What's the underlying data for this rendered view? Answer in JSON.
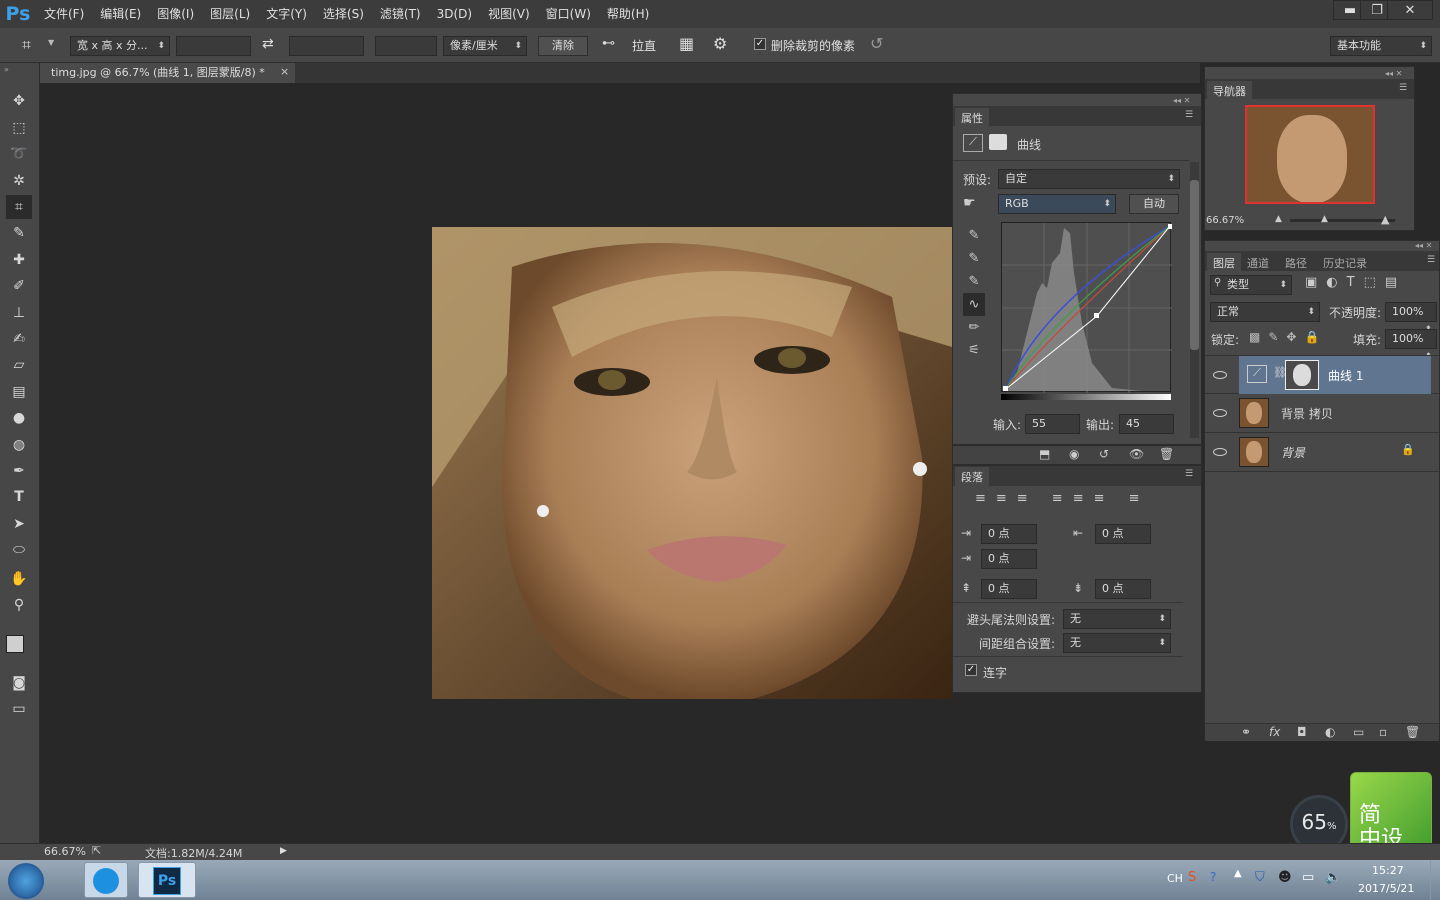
{
  "app": {
    "logo": "Ps",
    "accent": "#3da0e8"
  },
  "menubar": {
    "items": [
      "文件(F)",
      "编辑(E)",
      "图像(I)",
      "图层(L)",
      "文字(Y)",
      "选择(S)",
      "滤镜(T)",
      "3D(D)",
      "视图(V)",
      "窗口(W)",
      "帮助(H)"
    ],
    "window_buttons": [
      "▬",
      "❐",
      "✕"
    ]
  },
  "options": {
    "ratio": "宽 x 高 x 分...",
    "unit": "像素/厘米",
    "clear": "清除",
    "straighten": "拉直",
    "delete_cropped": "删除裁剪的像素",
    "workspace": "基本功能"
  },
  "document": {
    "tab_title": "timg.jpg @ 66.7% (曲线 1, 图层蒙版/8) *",
    "close": "×"
  },
  "properties": {
    "tab": "属性",
    "title": "曲线",
    "preset_label": "预设:",
    "preset_value": "自定",
    "channel": "RGB",
    "auto": "自动",
    "input_label": "输入:",
    "input_value": "55",
    "output_label": "输出:",
    "output_value": "45"
  },
  "paragraph": {
    "tab": "段落",
    "fields": [
      "0 点",
      "0 点",
      "0 点",
      "0 点",
      "0 点"
    ],
    "hyphen_label": "避头尾法则设置:",
    "hyphen_value": "无",
    "spacing_label": "间距组合设置:",
    "spacing_value": "无",
    "ligature_label": "连字"
  },
  "navigator": {
    "tab": "导航器",
    "zoom": "66.67%"
  },
  "layers": {
    "tabs": [
      "图层",
      "通道",
      "路径",
      "历史记录"
    ],
    "filter": "类型",
    "blend": "正常",
    "opacity_label": "不透明度:",
    "opacity_value": "100%",
    "lock_label": "锁定:",
    "fill_label": "填充:",
    "fill_value": "100%",
    "items": [
      {
        "name": "曲线 1"
      },
      {
        "name": "背景 拷贝"
      },
      {
        "name": "背景"
      }
    ],
    "footer": [
      "⚭",
      "fx",
      "◘",
      "◐",
      "▭",
      "▫",
      "🗑"
    ]
  },
  "status": {
    "zoom": "66.67%",
    "doc": "文档:1.82M/4.24M"
  },
  "overlay": {
    "percent": "65",
    "unit": "%",
    "badge_line1": "简",
    "badge_line2": "中设"
  },
  "taskbar": {
    "lang": "CH",
    "time": "15:27",
    "date": "2017/5/21",
    "ps_label": "Ps"
  }
}
